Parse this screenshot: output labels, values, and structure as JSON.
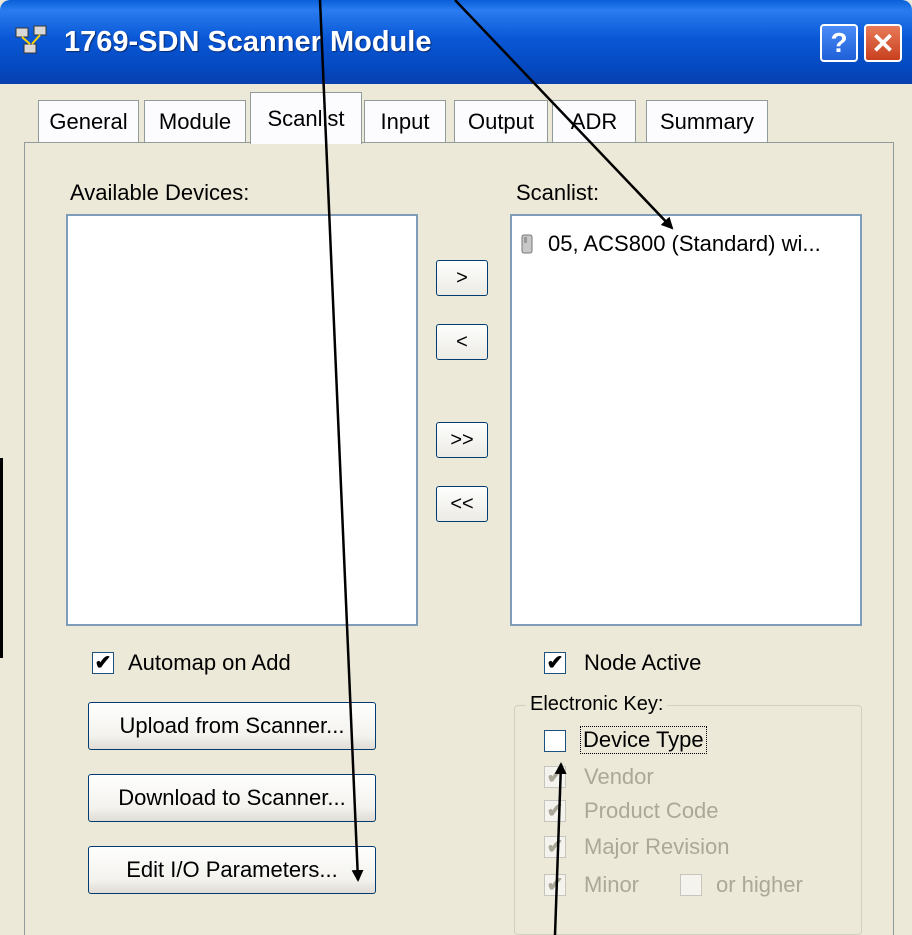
{
  "window": {
    "title": "1769-SDN Scanner Module",
    "help_label": "?",
    "close_label": "✕"
  },
  "tabs": [
    {
      "label": "General",
      "active": false
    },
    {
      "label": "Module",
      "active": false
    },
    {
      "label": "Scanlist",
      "active": true
    },
    {
      "label": "Input",
      "active": false
    },
    {
      "label": "Output",
      "active": false
    },
    {
      "label": "ADR",
      "active": false
    },
    {
      "label": "Summary",
      "active": false
    }
  ],
  "available_devices": {
    "label": "Available Devices:",
    "items": []
  },
  "scanlist": {
    "label": "Scanlist:",
    "items": [
      {
        "text": "05, ACS800 (Standard) wi...",
        "icon": "device-icon"
      }
    ]
  },
  "move_buttons": {
    "add_one": ">",
    "remove_one": "<",
    "add_all": ">>",
    "remove_all": "<<"
  },
  "automap": {
    "label": "Automap on Add",
    "checked": true
  },
  "node_active": {
    "label": "Node Active",
    "checked": true
  },
  "buttons": {
    "upload": "Upload from Scanner...",
    "download": "Download to Scanner...",
    "edit_io": "Edit I/O Parameters..."
  },
  "electronic_key": {
    "title": "Electronic Key:",
    "device_type": {
      "label": "Device Type",
      "checked": false,
      "enabled": true
    },
    "vendor": {
      "label": "Vendor",
      "checked": true,
      "enabled": false
    },
    "product_code": {
      "label": "Product Code",
      "checked": true,
      "enabled": false
    },
    "major_revision": {
      "label": "Major Revision",
      "checked": true,
      "enabled": false
    },
    "minor": {
      "label": "Minor",
      "checked": true,
      "enabled": false
    },
    "or_higher": {
      "label": "or higher",
      "checked": false,
      "enabled": false
    }
  },
  "colors": {
    "titlebar": "#0a58d6",
    "dialog_face": "#ece9d8",
    "list_border": "#7f9db9",
    "button_border": "#003c74",
    "disabled_text": "#aca899"
  }
}
